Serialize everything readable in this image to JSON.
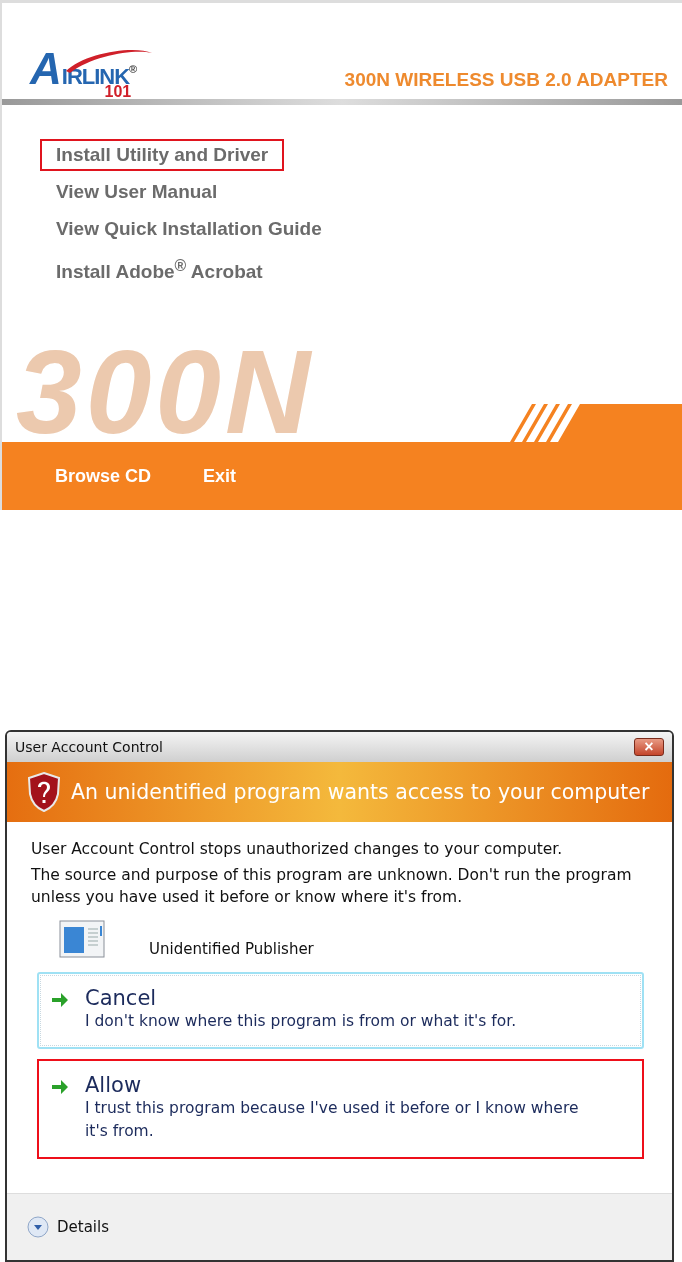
{
  "installer": {
    "logo": {
      "initial": "A",
      "rest": "IRLINK",
      "mark": "®",
      "number": "101"
    },
    "product_title": "300N WIRELESS USB 2.0 ADAPTER",
    "menu": [
      {
        "label": "Install Utility and Driver",
        "highlighted": true
      },
      {
        "label": "View User Manual",
        "highlighted": false
      },
      {
        "label": "View Quick Installation Guide",
        "highlighted": false
      },
      {
        "label": "Install Adobe$^{®}$ Acrobat",
        "highlighted": false
      }
    ],
    "backdrop_text": "300N",
    "footer_buttons": [
      "Browse CD",
      "Exit"
    ]
  },
  "dialog": {
    "title": "User Account Control",
    "close": "×",
    "banner": "An unidentified program wants access to your computer",
    "lines": [
      "User Account Control stops unauthorized changes to your computer.",
      "The source and purpose of this program are unknown.  Don't run the program unless you have used it before or know where it's from."
    ],
    "publisher": "Unidentified Publisher",
    "options": [
      {
        "title": "Cancel",
        "description": "I don't know where this program is from or what it's for.",
        "focused": true,
        "highlighted": false
      },
      {
        "title": "Allow",
        "description": "I trust this program because I've used it before or I know where it's from.",
        "focused": false,
        "highlighted": true
      }
    ],
    "details": "Details"
  }
}
